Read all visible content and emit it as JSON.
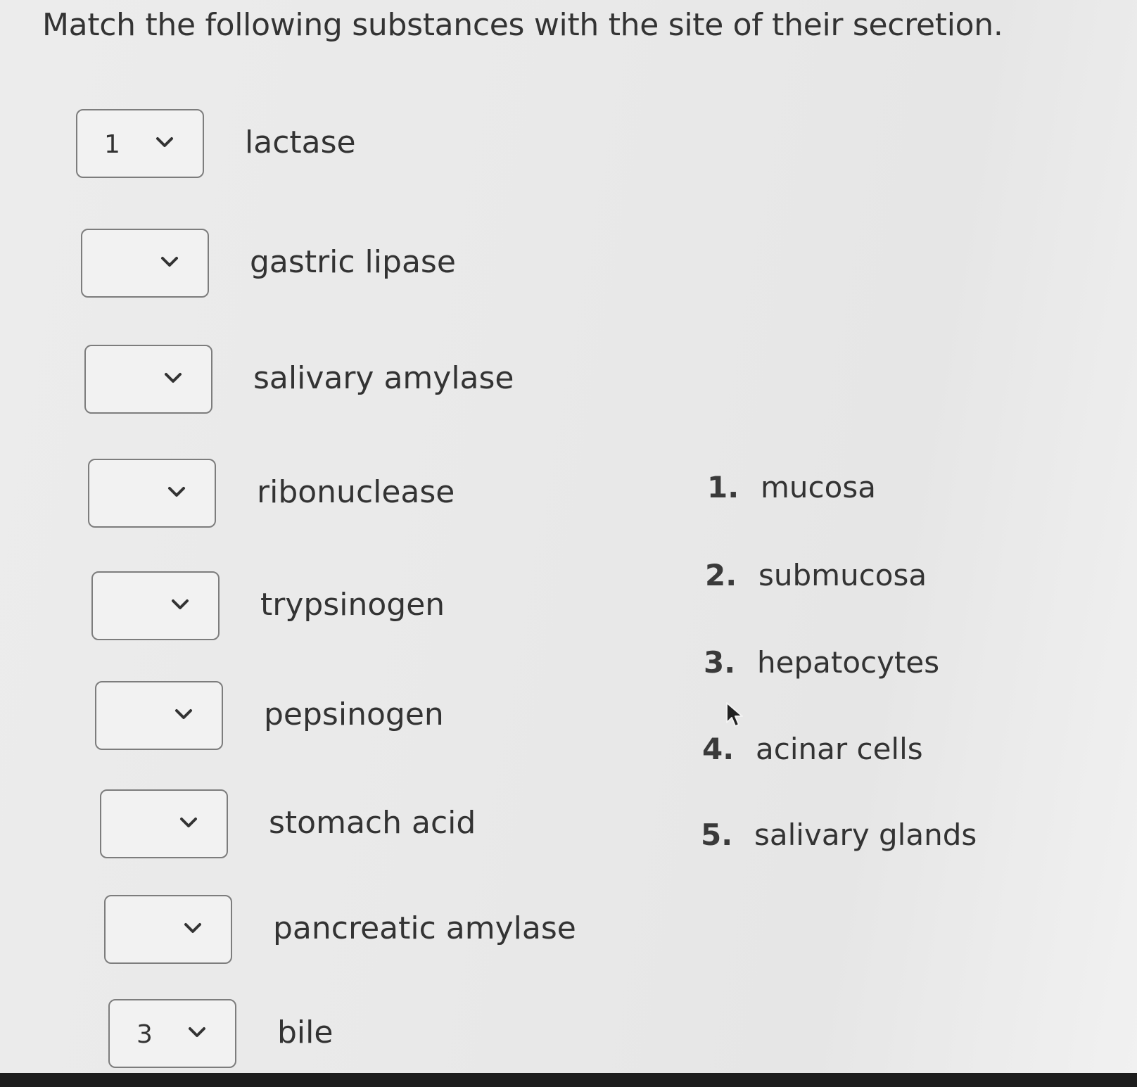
{
  "question": {
    "title": "Match the following substances with the site of their secretion."
  },
  "rows": [
    {
      "selected": "1",
      "label": "lactase"
    },
    {
      "selected": "",
      "label": "gastric lipase"
    },
    {
      "selected": "",
      "label": "salivary amylase"
    },
    {
      "selected": "",
      "label": "ribonuclease"
    },
    {
      "selected": "",
      "label": "trypsinogen"
    },
    {
      "selected": "",
      "label": "pepsinogen"
    },
    {
      "selected": "",
      "label": "stomach acid"
    },
    {
      "selected": "",
      "label": "pancreatic amylase"
    },
    {
      "selected": "3",
      "label": "bile"
    }
  ],
  "options": [
    {
      "number": "1.",
      "label": "mucosa"
    },
    {
      "number": "2.",
      "label": "submucosa"
    },
    {
      "number": "3.",
      "label": "hepatocytes"
    },
    {
      "number": "4.",
      "label": "acinar cells"
    },
    {
      "number": "5.",
      "label": "salivary glands"
    }
  ],
  "icons": {
    "dropdown": "chevron-down-icon",
    "pointer": "mouse-cursor-icon"
  },
  "colors": {
    "text": "#333333",
    "select_border": "#7d7d7d",
    "background": "#e9e9e9"
  }
}
